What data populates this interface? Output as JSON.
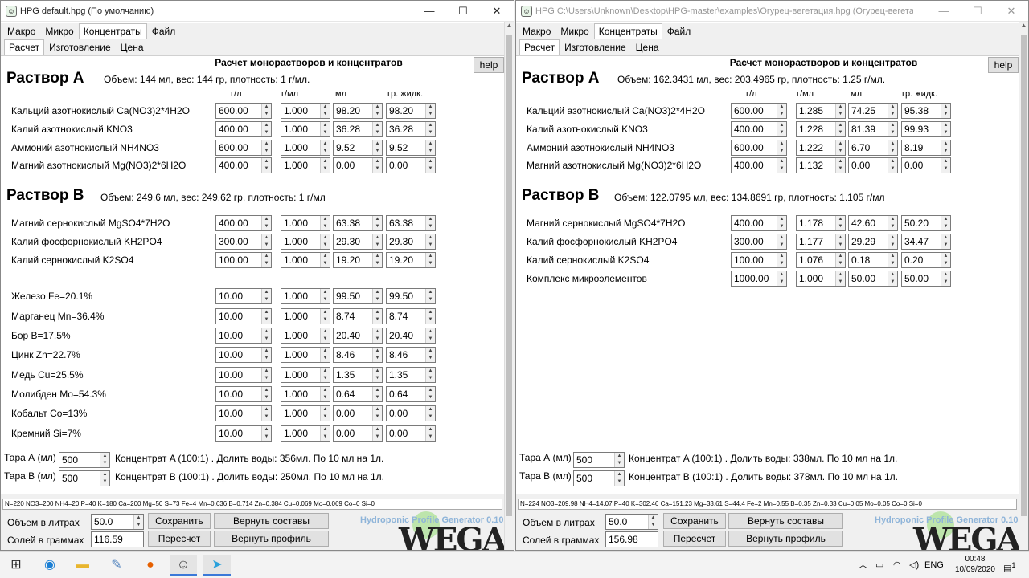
{
  "left": {
    "title": "HPG default.hpg (По умолчанию)",
    "menu_tabs": [
      "Макро",
      "Микро",
      "Концентраты",
      "Файл"
    ],
    "sub_tabs": [
      "Расчет",
      "Изготовление",
      "Цена"
    ],
    "heading": "Расчет монорастворов и концентратов",
    "help": "help",
    "col_headers": [
      "г/л",
      "г/мл",
      "мл",
      "гр. жидк."
    ],
    "solA": {
      "title": "Раствор A",
      "info": "Объем: 144 мл, вес: 144 гр, плотность: 1 г/мл."
    },
    "rowsA": [
      {
        "label": "Кальций азотнокислый Ca(NO3)2*4H2O",
        "gl": "600.00",
        "gml": "1.000",
        "ml": "98.20",
        "gr": "98.20"
      },
      {
        "label": "Калий азотнокислый KNO3",
        "gl": "400.00",
        "gml": "1.000",
        "ml": "36.28",
        "gr": "36.28"
      },
      {
        "label": "Аммоний азотнокислый NH4NO3",
        "gl": "600.00",
        "gml": "1.000",
        "ml": "9.52",
        "gr": "9.52"
      },
      {
        "label": "Магний азотнокислый Mg(NO3)2*6H2O",
        "gl": "400.00",
        "gml": "1.000",
        "ml": "0.00",
        "gr": "0.00"
      }
    ],
    "solB": {
      "title": "Раствор B",
      "info": "Объем: 249.6 мл, вес: 249.62 гр, плотность: 1 г/мл"
    },
    "rowsB": [
      {
        "label": "Магний сернокислый MgSO4*7H2O",
        "gl": "400.00",
        "gml": "1.000",
        "ml": "63.38",
        "gr": "63.38"
      },
      {
        "label": "Калий фосфорнокислый KH2PO4",
        "gl": "300.00",
        "gml": "1.000",
        "ml": "29.30",
        "gr": "29.30"
      },
      {
        "label": "Калий сернокислый K2SO4",
        "gl": "100.00",
        "gml": "1.000",
        "ml": "19.20",
        "gr": "19.20"
      }
    ],
    "rowsMicro": [
      {
        "label": "Железо Fe=20.1%",
        "gl": "10.00",
        "gml": "1.000",
        "ml": "99.50",
        "gr": "99.50"
      },
      {
        "label": "Марганец Mn=36.4%",
        "gl": "10.00",
        "gml": "1.000",
        "ml": "8.74",
        "gr": "8.74"
      },
      {
        "label": "Бор B=17.5%",
        "gl": "10.00",
        "gml": "1.000",
        "ml": "20.40",
        "gr": "20.40"
      },
      {
        "label": "Цинк Zn=22.7%",
        "gl": "10.00",
        "gml": "1.000",
        "ml": "8.46",
        "gr": "8.46"
      },
      {
        "label": "Медь Cu=25.5%",
        "gl": "10.00",
        "gml": "1.000",
        "ml": "1.35",
        "gr": "1.35"
      },
      {
        "label": "Молибден Mo=54.3%",
        "gl": "10.00",
        "gml": "1.000",
        "ml": "0.64",
        "gr": "0.64"
      },
      {
        "label": "Кобальт Co=13%",
        "gl": "10.00",
        "gml": "1.000",
        "ml": "0.00",
        "gr": "0.00"
      },
      {
        "label": "Кремний Si=7%",
        "gl": "10.00",
        "gml": "1.000",
        "ml": "0.00",
        "gr": "0.00"
      }
    ],
    "taraA": {
      "label": "Тара А (мл)",
      "value": "500",
      "text": "Концентрат A (100:1) . Долить воды: 356мл. По 10 мл на 1л."
    },
    "taraB": {
      "label": "Тара B (мл)",
      "value": "500",
      "text": "Концентрат B (100:1) . Долить воды: 250мл. По 10 мл на 1л."
    },
    "status": "N=220 NO3=200 NH4=20 P=40 K=180 Ca=200 Mg=50 S=73 Fe=4 Mn=0.636 B=0.714 Zn=0.384 Cu=0.069 Mo=0.069 Co=0 Si=0",
    "vol_label": "Объем в литрах",
    "vol_value": "50.0",
    "salt_label": "Солей в граммах",
    "salt_value": "116.59",
    "save": "Сохранить",
    "restore": "Вернуть составы",
    "recalc": "Пересчет",
    "restore_profile": "Вернуть профиль",
    "brand": "Hydroponic Profile Generator 0.10",
    "logo": "WEGA"
  },
  "right": {
    "title": "HPG C:\\Users\\Unknown\\Desktop\\HPG-master\\examples\\Огурец-вегетация.hpg (Огурец-вегетация)",
    "solA": {
      "title": "Раствор A",
      "info": "Объем: 162.3431 мл, вес: 203.4965 гр, плотность: 1.25 г/мл."
    },
    "rowsA": [
      {
        "label": "Кальций азотнокислый Ca(NO3)2*4H2O",
        "gl": "600.00",
        "gml": "1.285",
        "ml": "74.25",
        "gr": "95.38"
      },
      {
        "label": "Калий азотнокислый KNO3",
        "gl": "400.00",
        "gml": "1.228",
        "ml": "81.39",
        "gr": "99.93"
      },
      {
        "label": "Аммоний азотнокислый NH4NO3",
        "gl": "600.00",
        "gml": "1.222",
        "ml": "6.70",
        "gr": "8.19"
      },
      {
        "label": "Магний азотнокислый Mg(NO3)2*6H2O",
        "gl": "400.00",
        "gml": "1.132",
        "ml": "0.00",
        "gr": "0.00"
      }
    ],
    "solB": {
      "title": "Раствор B",
      "info": "Объем: 122.0795 мл, вес: 134.8691 гр, плотность: 1.105 г/мл"
    },
    "rowsB": [
      {
        "label": "Магний сернокислый MgSO4*7H2O",
        "gl": "400.00",
        "gml": "1.178",
        "ml": "42.60",
        "gr": "50.20"
      },
      {
        "label": "Калий фосфорнокислый KH2PO4",
        "gl": "300.00",
        "gml": "1.177",
        "ml": "29.29",
        "gr": "34.47"
      },
      {
        "label": "Калий сернокислый K2SO4",
        "gl": "100.00",
        "gml": "1.076",
        "ml": "0.18",
        "gr": "0.20"
      },
      {
        "label": "Комплекс микроэлементов",
        "gl": "1000.00",
        "gml": "1.000",
        "ml": "50.00",
        "gr": "50.00"
      }
    ],
    "taraA": {
      "label": "Тара А (мл)",
      "value": "500",
      "text": "Концентрат A (100:1) . Долить воды: 338мл. По 10 мл на 1л."
    },
    "taraB": {
      "label": "Тара B (мл)",
      "value": "500",
      "text": "Концентрат B (100:1) . Долить воды: 378мл. По 10 мл на 1л."
    },
    "status": "N=224 NO3=209.98 NH4=14.07 P=40 K=302.46 Ca=151.23 Mg=33.61 S=44.4 Fe=2 Mn=0.55 B=0.35 Zn=0.33 Cu=0.05 Mo=0.05 Co=0 Si=0",
    "vol_value": "50.0",
    "salt_value": "156.98"
  },
  "taskbar": {
    "lang": "ENG",
    "time": "00:48",
    "date": "10/09/2020",
    "notifications": "1"
  }
}
